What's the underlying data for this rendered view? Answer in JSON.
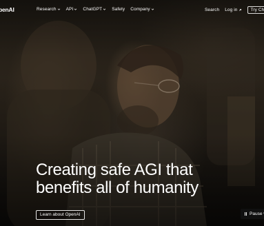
{
  "nav": {
    "logo": "penAI",
    "links": [
      {
        "label": "Research",
        "has_dropdown": true
      },
      {
        "label": "API",
        "has_dropdown": true
      },
      {
        "label": "ChatGPT",
        "has_dropdown": true
      },
      {
        "label": "Safety",
        "has_dropdown": false
      },
      {
        "label": "Company",
        "has_dropdown": true
      }
    ],
    "search_label": "Search",
    "login_label": "Log in",
    "try_label": "Try ChatG"
  },
  "hero": {
    "headline_line1": "Creating safe AGI that",
    "headline_line2": "benefits all of humanity",
    "learn_button": "Learn about OpenAI",
    "pause_button": "Pause v"
  },
  "colors": {
    "text": "#ffffff",
    "background": "#0c0b09",
    "pause_bg": "#101010"
  }
}
